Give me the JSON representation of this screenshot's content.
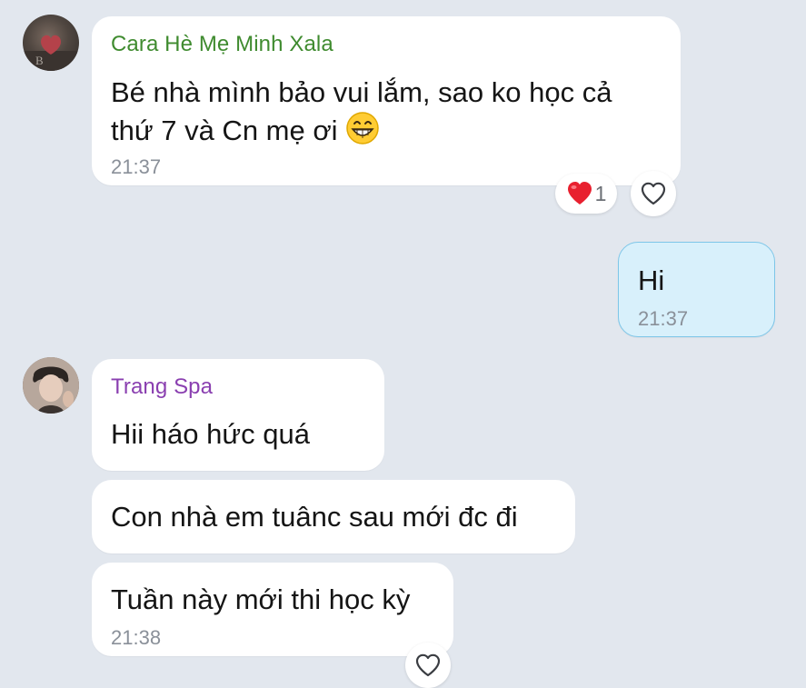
{
  "messages": [
    {
      "sender": "Cara Hè Mẹ Minh Xala",
      "sender_color": "#3f8b2f",
      "line1": "Bé nhà mình bảo vui lắm, sao ko học cả",
      "line2": "thứ 7 và Cn mẹ ơi",
      "emoji": "grinning-face-emoji",
      "time": "21:37",
      "reaction": {
        "icon": "red-heart-icon",
        "count": "1"
      }
    },
    {
      "mine": true,
      "text": "Hi",
      "time": "21:37"
    },
    {
      "sender": "Trang Spa",
      "sender_color": "#8a3fb0",
      "text": "Hii háo hức quá"
    },
    {
      "text": "Con nhà em tuânc sau mới đc đi"
    },
    {
      "text": "Tuần này mới thi học kỳ",
      "time": "21:38"
    }
  ],
  "colors": {
    "background": "#e2e7ee",
    "bubble_other": "#ffffff",
    "bubble_mine": "#d8f0fb",
    "bubble_mine_border": "#7dc6e8",
    "time": "#8a9099"
  }
}
